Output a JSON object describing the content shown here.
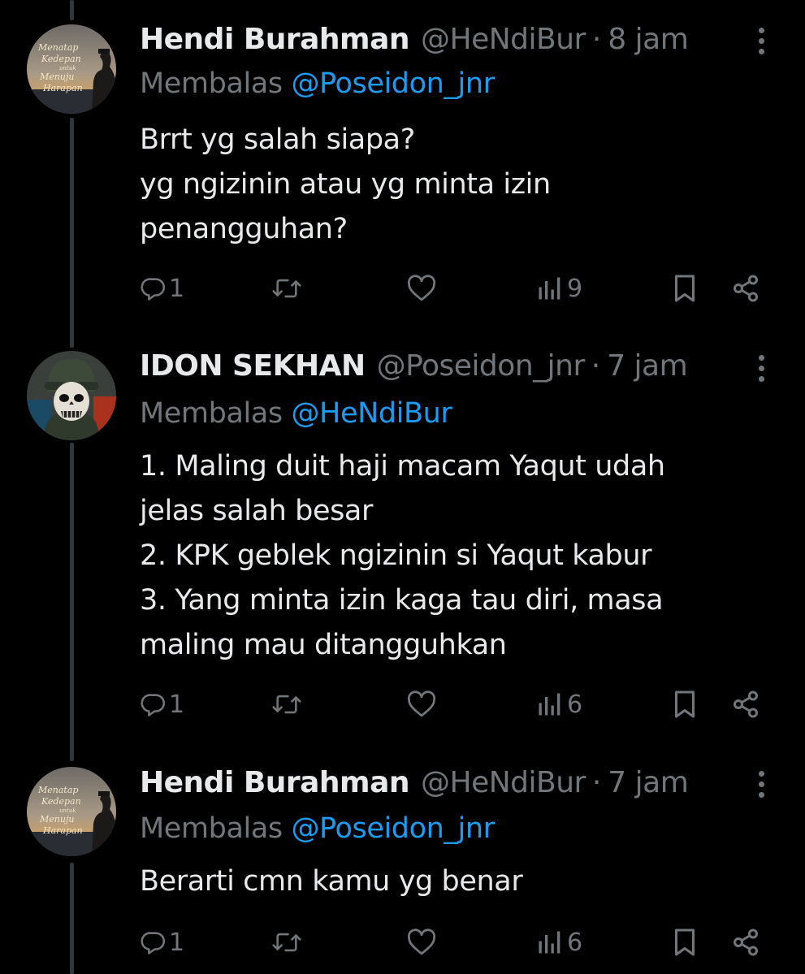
{
  "tweets": [
    {
      "name": "Hendi Burahman",
      "handle": "@HeNdiBur",
      "separator": "·",
      "time": "8 jam",
      "reply_prefix": "Membalas",
      "reply_to": "@Poseidon_jnr",
      "lines": [
        "Brrt yg salah siapa?",
        "yg ngizinin atau yg minta izin",
        "penangguhan?"
      ],
      "replies": "1",
      "views": "9",
      "avatar_text": [
        "Menatap",
        "Kedepan",
        "untuk",
        "Menuju",
        "Harapan"
      ]
    },
    {
      "name": "IDON SEKHAN",
      "handle": "@Poseidon_jnr",
      "separator": "·",
      "time": "7 jam",
      "reply_prefix": "Membalas",
      "reply_to": "@HeNdiBur",
      "lines": [
        "1. Maling duit haji macam Yaqut udah",
        "jelas salah besar",
        "2. KPK geblek ngizinin si Yaqut kabur",
        "3. Yang minta izin kaga tau diri, masa",
        "maling mau ditangguhkan"
      ],
      "replies": "1",
      "views": "6"
    },
    {
      "name": "Hendi Burahman",
      "handle": "@HeNdiBur",
      "separator": "·",
      "time": "7 jam",
      "reply_prefix": "Membalas",
      "reply_to": "@Poseidon_jnr",
      "lines": [
        "Berarti cmn kamu yg benar"
      ],
      "replies": "1",
      "views": "6",
      "avatar_text": [
        "Menatap",
        "Kedepan",
        "untuk",
        "Menuju",
        "Harapan"
      ]
    }
  ],
  "icons": {
    "reply": "reply-icon",
    "retweet": "retweet-icon",
    "like": "heart-icon",
    "views": "views-icon",
    "bookmark": "bookmark-icon",
    "share": "share-icon",
    "more": "more-icon"
  },
  "colors": {
    "background": "#000000",
    "text": "#e7e9ea",
    "muted": "#71767b",
    "link": "#1d9bf0",
    "thread_line": "#333639"
  }
}
